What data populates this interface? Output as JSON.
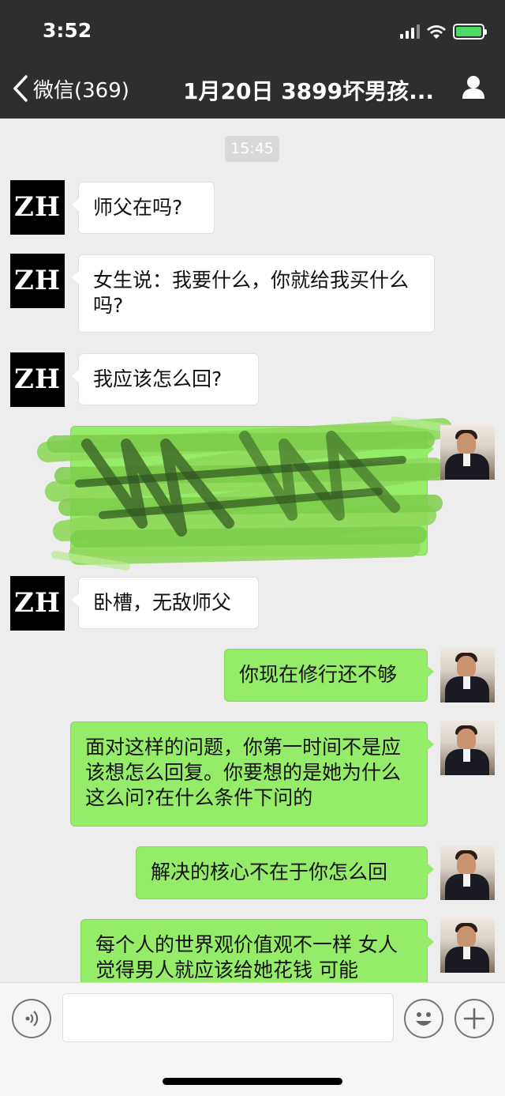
{
  "status_bar": {
    "time": "3:52"
  },
  "nav": {
    "back_label": "微信(369)",
    "title": "1月20日 3899坏男孩..."
  },
  "chat": {
    "timestamp": "15:45",
    "avatar_zh_text": "ZH",
    "messages": [
      {
        "side": "in",
        "text": "师父在吗?"
      },
      {
        "side": "in",
        "text": "女生说：我要什么，你就给我买什么吗?"
      },
      {
        "side": "in",
        "text": "我应该怎么回?"
      },
      {
        "side": "out",
        "text": "",
        "note": "redacted"
      },
      {
        "side": "in",
        "text": "卧槽，无敌师父"
      },
      {
        "side": "out",
        "text": "你现在修行还不够"
      },
      {
        "side": "out",
        "text": "面对这样的问题，你第一时间不是应该想怎么回复。你要想的是她为什么这么问?在什么条件下问的"
      },
      {
        "side": "out",
        "text": "解决的核心不在于你怎么回"
      },
      {
        "side": "out",
        "text": "每个人的世界观价值观不一样 女人觉得男人就应该给她花钱 可能"
      }
    ]
  },
  "input_bar": {
    "value": "",
    "placeholder": ""
  },
  "colors": {
    "header_bg": "#2e2e30",
    "chat_bg": "#ededed",
    "outgoing_bubble": "#95ec69",
    "incoming_bubble": "#ffffff",
    "battery": "#4cd964"
  }
}
